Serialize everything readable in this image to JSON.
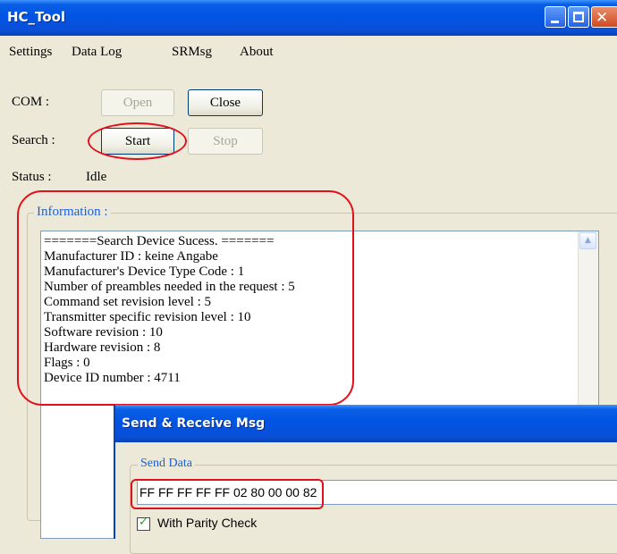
{
  "main_window": {
    "title": "HC_Tool",
    "close_glyph": "✕",
    "menu": [
      "Settings",
      "Data Log",
      "SRMsg",
      "About"
    ],
    "com_label": "COM :",
    "open_label": "Open",
    "close_label": "Close",
    "search_label": "Search :",
    "start_label": "Start",
    "stop_label": "Stop",
    "status_label": "Status :",
    "status_value": "Idle",
    "information_title": "Information :",
    "information_lines": [
      "=======Search Device Sucess. =======",
      "Manufacturer ID : keine Angabe",
      "Manufacturer's Device Type Code : 1",
      "Number of preambles needed in the request : 5",
      "Command set revision level : 5",
      "Transmitter specific revision level : 10",
      "Software revision : 10",
      "Hardware revision : 8",
      "Flags : 0",
      "Device ID number : 4711"
    ],
    "scroll_up_glyph": "▲"
  },
  "srmsg_window": {
    "title": "Send & Receive Msg",
    "send_group_title": "Send Data",
    "send_value": "FF FF FF FF FF 02 80 00 00 82",
    "parity_check_label": "With Parity Check",
    "parity_checked": true,
    "check_glyph": "✓"
  },
  "annotation_color": "#e0111a"
}
